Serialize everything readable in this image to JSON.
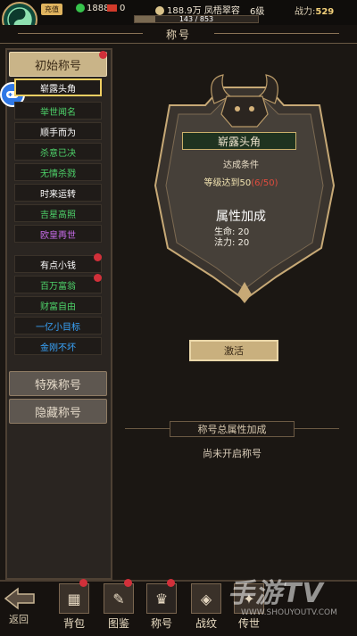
{
  "topbar": {
    "vip": "充值",
    "gold": "18888",
    "coupon": "0",
    "silver": "188.9万",
    "name": "凤梧翠容",
    "level": "6级",
    "power_label": "战力:",
    "power_value": "529",
    "exp_text": "143 / 853",
    "exp_progress": 0.168
  },
  "page_title": "称号",
  "sidebar": {
    "categories": [
      {
        "label": "初始称号"
      },
      {
        "label": "特殊称号"
      },
      {
        "label": "隐藏称号"
      }
    ],
    "items": [
      {
        "label": "崭露头角",
        "color": "#ffffff"
      },
      {
        "label": "举世闻名",
        "color": "#4ed36a"
      },
      {
        "label": "顺手而为",
        "color": "#ffffff"
      },
      {
        "label": "杀意已决",
        "color": "#4ed36a"
      },
      {
        "label": "无情杀戮",
        "color": "#4ed36a"
      },
      {
        "label": "时来运转",
        "color": "#ffffff"
      },
      {
        "label": "吉星高照",
        "color": "#4ed36a"
      },
      {
        "label": "欧皇再世",
        "color": "#c66be8"
      },
      {
        "label": "有点小钱",
        "color": "#ffffff"
      },
      {
        "label": "百万富翁",
        "color": "#4ed36a"
      },
      {
        "label": "财富自由",
        "color": "#4ed36a"
      },
      {
        "label": "一亿小目标",
        "color": "#3aa7ff"
      },
      {
        "label": "金刚不坏",
        "color": "#3aa7ff"
      }
    ]
  },
  "detail": {
    "badge": "崭露头角",
    "condition_title": "达成条件",
    "condition_text": "等级达到50",
    "condition_progress": "(6/50)",
    "attr_title": "属性加成",
    "attrs": [
      "生命: 20",
      "法力: 20"
    ],
    "activate": "激活"
  },
  "summary": {
    "title": "称号总属性加成",
    "text": "尚未开启称号"
  },
  "bottom_nav": {
    "back": "返回",
    "items": [
      {
        "label": "背包"
      },
      {
        "label": "图鉴"
      },
      {
        "label": "称号"
      },
      {
        "label": "战纹"
      },
      {
        "label": "传世"
      }
    ]
  },
  "watermark": {
    "main": "手游TV",
    "sub": "WWW.SHOUYOUTV.COM"
  }
}
